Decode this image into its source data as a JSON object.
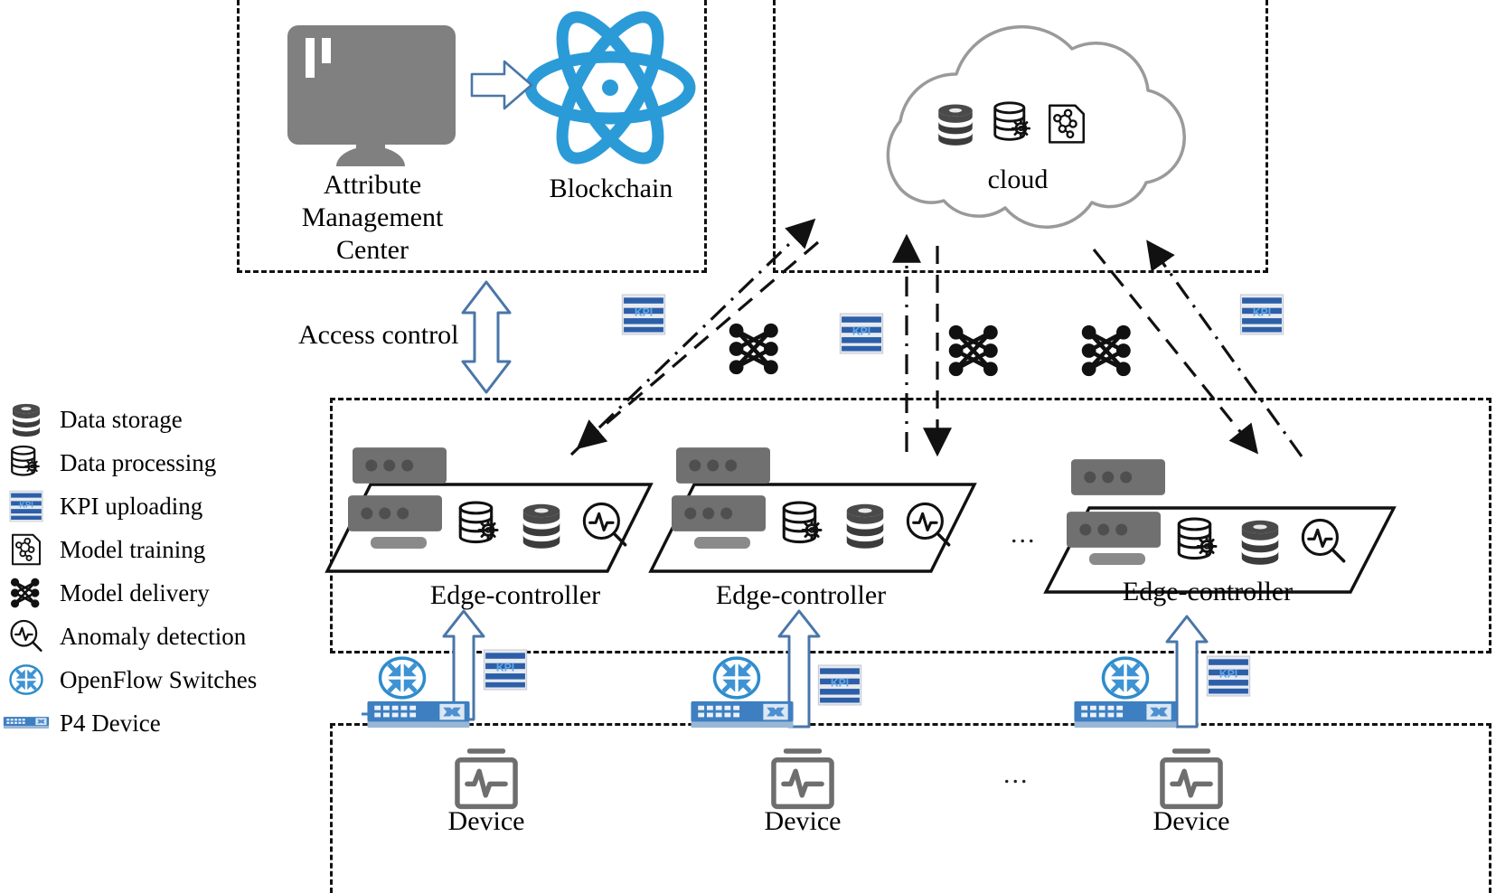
{
  "diagram": {
    "title": "Blockchain-assisted edge-cloud intelligent network architecture",
    "colors": {
      "blockchain_blue": "#2b9bd8",
      "kpi_blue": "#2c5fa8",
      "p4_blue": "#3d7fc1",
      "openflow_blue": "#2e8ccc",
      "arrow_blue": "#4a76a8",
      "device_gray": "#6e6e6e",
      "monitor_gray": "#808080",
      "cloud_gray": "#9a9a9a",
      "dash_black": "#111111"
    }
  },
  "legend": {
    "items": [
      {
        "icon": "data-storage-icon",
        "label": "Data storage"
      },
      {
        "icon": "data-processing-icon",
        "label": "Data processing"
      },
      {
        "icon": "kpi-uploading-icon",
        "label": "KPI uploading"
      },
      {
        "icon": "model-training-icon",
        "label": "Model training"
      },
      {
        "icon": "model-delivery-icon",
        "label": "Model delivery"
      },
      {
        "icon": "anomaly-detection-icon",
        "label": "Anomaly detection"
      },
      {
        "icon": "openflow-switch-icon",
        "label": "OpenFlow Switches"
      },
      {
        "icon": "p4-device-icon",
        "label": "P4 Device"
      }
    ]
  },
  "management_plane": {
    "attribute_center_label": "Attribute\nManagement\nCenter",
    "attribute_center_lines": [
      "Attribute",
      "Management",
      "Center"
    ],
    "blockchain_label": "Blockchain"
  },
  "cloud_plane": {
    "cloud_label": "cloud",
    "cloud_icons": [
      "data-storage-icon",
      "data-processing-icon",
      "model-training-icon"
    ]
  },
  "access": {
    "label": "Access control"
  },
  "edge_plane": {
    "controllers": [
      {
        "label": "Edge-controller",
        "icons": [
          "data-processing-icon",
          "data-storage-icon",
          "anomaly-detection-icon"
        ]
      },
      {
        "label": "Edge-controller",
        "icons": [
          "data-processing-icon",
          "data-storage-icon",
          "anomaly-detection-icon"
        ]
      },
      {
        "label": "Edge-controller",
        "icons": [
          "data-processing-icon",
          "data-storage-icon",
          "anomaly-detection-icon"
        ]
      }
    ],
    "ellipsis": "..."
  },
  "switch_plane": {
    "nodes": [
      {
        "openflow": "openflow-switch-icon",
        "p4": "p4-device-icon",
        "kpi": "kpi-uploading-icon"
      },
      {
        "openflow": "openflow-switch-icon",
        "p4": "p4-device-icon",
        "kpi": "kpi-uploading-icon"
      },
      {
        "openflow": "openflow-switch-icon",
        "p4": "p4-device-icon",
        "kpi": "kpi-uploading-icon"
      }
    ]
  },
  "device_plane": {
    "devices": [
      {
        "label": "Device"
      },
      {
        "label": "Device"
      },
      {
        "label": "Device"
      }
    ],
    "ellipsis": "..."
  },
  "middle_band": {
    "kpi_icons": 3,
    "model_delivery_icons": 3
  }
}
